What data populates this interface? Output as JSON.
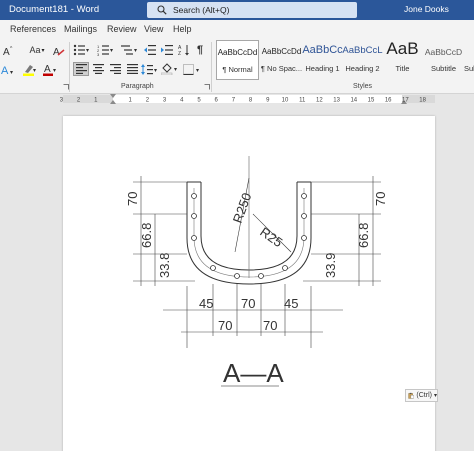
{
  "window": {
    "title": "Document181  -  Word",
    "search_placeholder": "Search (Alt+Q)",
    "account_name": "Jone Dooks"
  },
  "menu": [
    "References",
    "Mailings",
    "Review",
    "View",
    "Help"
  ],
  "ribbon": {
    "font_size_label": "Aa",
    "group_paragraph": "Paragraph",
    "group_styles": "Styles",
    "styles": [
      {
        "sample": "AaBbCcDd",
        "name": "¶ Normal",
        "selected": true
      },
      {
        "sample": "AaBbCcDd",
        "name": "¶ No Spac...",
        "selected": false
      },
      {
        "sample": "AaBbCc",
        "name": "Heading 1",
        "selected": false
      },
      {
        "sample": "AaBbCcL",
        "name": "Heading 2",
        "selected": false
      },
      {
        "sample": "AaB",
        "name": "Title",
        "selected": false
      },
      {
        "sample": "AaBbCcD",
        "name": "Subtitle",
        "selected": false
      },
      {
        "sample": "",
        "name": "Sub",
        "selected": false
      }
    ]
  },
  "ruler": {
    "left_labels": [
      "3",
      "2",
      "1"
    ],
    "right_labels": [
      "1",
      "2",
      "3",
      "4",
      "5",
      "6",
      "7",
      "8",
      "9",
      "10",
      "11",
      "12",
      "13",
      "14",
      "15",
      "16",
      "17",
      "18"
    ]
  },
  "drawing": {
    "dim_70_left": "70",
    "dim_668_left": "66.8",
    "dim_338_left": "33.8",
    "dim_70_right": "70",
    "dim_668_right": "66.8",
    "dim_339_right": "33.9",
    "radius_outer": "R250",
    "radius_inner": "R25",
    "bottom_45_left": "45",
    "bottom_70_mid": "70",
    "bottom_45_right": "45",
    "bottom_70_left": "70",
    "bottom_70_right": "70",
    "section_label": "A—A"
  },
  "paste_options": {
    "label": "(Ctrl)"
  },
  "colors": {
    "titlebar": "#2b579a",
    "ribbon": "#f3f3f3",
    "canvas": "#e6e6e6",
    "highlight": "#ffff00",
    "font_color": "#c00000"
  }
}
